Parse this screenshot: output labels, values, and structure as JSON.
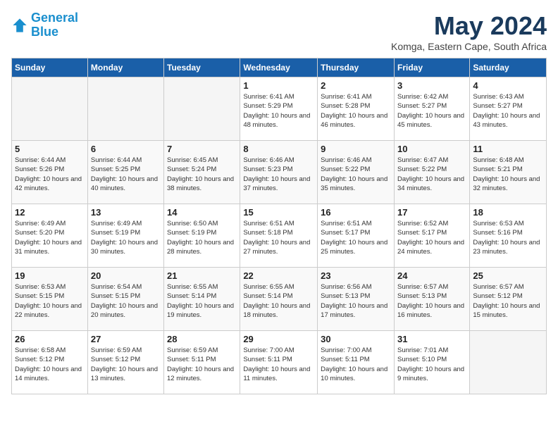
{
  "logo": {
    "line1": "General",
    "line2": "Blue"
  },
  "title": "May 2024",
  "subtitle": "Komga, Eastern Cape, South Africa",
  "weekdays": [
    "Sunday",
    "Monday",
    "Tuesday",
    "Wednesday",
    "Thursday",
    "Friday",
    "Saturday"
  ],
  "weeks": [
    [
      {
        "day": "",
        "empty": true
      },
      {
        "day": "",
        "empty": true
      },
      {
        "day": "",
        "empty": true
      },
      {
        "day": "1",
        "sunrise": "6:41 AM",
        "sunset": "5:29 PM",
        "daylight": "10 hours and 48 minutes."
      },
      {
        "day": "2",
        "sunrise": "6:41 AM",
        "sunset": "5:28 PM",
        "daylight": "10 hours and 46 minutes."
      },
      {
        "day": "3",
        "sunrise": "6:42 AM",
        "sunset": "5:27 PM",
        "daylight": "10 hours and 45 minutes."
      },
      {
        "day": "4",
        "sunrise": "6:43 AM",
        "sunset": "5:27 PM",
        "daylight": "10 hours and 43 minutes."
      }
    ],
    [
      {
        "day": "5",
        "sunrise": "6:44 AM",
        "sunset": "5:26 PM",
        "daylight": "10 hours and 42 minutes."
      },
      {
        "day": "6",
        "sunrise": "6:44 AM",
        "sunset": "5:25 PM",
        "daylight": "10 hours and 40 minutes."
      },
      {
        "day": "7",
        "sunrise": "6:45 AM",
        "sunset": "5:24 PM",
        "daylight": "10 hours and 38 minutes."
      },
      {
        "day": "8",
        "sunrise": "6:46 AM",
        "sunset": "5:23 PM",
        "daylight": "10 hours and 37 minutes."
      },
      {
        "day": "9",
        "sunrise": "6:46 AM",
        "sunset": "5:22 PM",
        "daylight": "10 hours and 35 minutes."
      },
      {
        "day": "10",
        "sunrise": "6:47 AM",
        "sunset": "5:22 PM",
        "daylight": "10 hours and 34 minutes."
      },
      {
        "day": "11",
        "sunrise": "6:48 AM",
        "sunset": "5:21 PM",
        "daylight": "10 hours and 32 minutes."
      }
    ],
    [
      {
        "day": "12",
        "sunrise": "6:49 AM",
        "sunset": "5:20 PM",
        "daylight": "10 hours and 31 minutes."
      },
      {
        "day": "13",
        "sunrise": "6:49 AM",
        "sunset": "5:19 PM",
        "daylight": "10 hours and 30 minutes."
      },
      {
        "day": "14",
        "sunrise": "6:50 AM",
        "sunset": "5:19 PM",
        "daylight": "10 hours and 28 minutes."
      },
      {
        "day": "15",
        "sunrise": "6:51 AM",
        "sunset": "5:18 PM",
        "daylight": "10 hours and 27 minutes."
      },
      {
        "day": "16",
        "sunrise": "6:51 AM",
        "sunset": "5:17 PM",
        "daylight": "10 hours and 25 minutes."
      },
      {
        "day": "17",
        "sunrise": "6:52 AM",
        "sunset": "5:17 PM",
        "daylight": "10 hours and 24 minutes."
      },
      {
        "day": "18",
        "sunrise": "6:53 AM",
        "sunset": "5:16 PM",
        "daylight": "10 hours and 23 minutes."
      }
    ],
    [
      {
        "day": "19",
        "sunrise": "6:53 AM",
        "sunset": "5:15 PM",
        "daylight": "10 hours and 22 minutes."
      },
      {
        "day": "20",
        "sunrise": "6:54 AM",
        "sunset": "5:15 PM",
        "daylight": "10 hours and 20 minutes."
      },
      {
        "day": "21",
        "sunrise": "6:55 AM",
        "sunset": "5:14 PM",
        "daylight": "10 hours and 19 minutes."
      },
      {
        "day": "22",
        "sunrise": "6:55 AM",
        "sunset": "5:14 PM",
        "daylight": "10 hours and 18 minutes."
      },
      {
        "day": "23",
        "sunrise": "6:56 AM",
        "sunset": "5:13 PM",
        "daylight": "10 hours and 17 minutes."
      },
      {
        "day": "24",
        "sunrise": "6:57 AM",
        "sunset": "5:13 PM",
        "daylight": "10 hours and 16 minutes."
      },
      {
        "day": "25",
        "sunrise": "6:57 AM",
        "sunset": "5:12 PM",
        "daylight": "10 hours and 15 minutes."
      }
    ],
    [
      {
        "day": "26",
        "sunrise": "6:58 AM",
        "sunset": "5:12 PM",
        "daylight": "10 hours and 14 minutes."
      },
      {
        "day": "27",
        "sunrise": "6:59 AM",
        "sunset": "5:12 PM",
        "daylight": "10 hours and 13 minutes."
      },
      {
        "day": "28",
        "sunrise": "6:59 AM",
        "sunset": "5:11 PM",
        "daylight": "10 hours and 12 minutes."
      },
      {
        "day": "29",
        "sunrise": "7:00 AM",
        "sunset": "5:11 PM",
        "daylight": "10 hours and 11 minutes."
      },
      {
        "day": "30",
        "sunrise": "7:00 AM",
        "sunset": "5:11 PM",
        "daylight": "10 hours and 10 minutes."
      },
      {
        "day": "31",
        "sunrise": "7:01 AM",
        "sunset": "5:10 PM",
        "daylight": "10 hours and 9 minutes."
      },
      {
        "day": "",
        "empty": true
      }
    ]
  ]
}
